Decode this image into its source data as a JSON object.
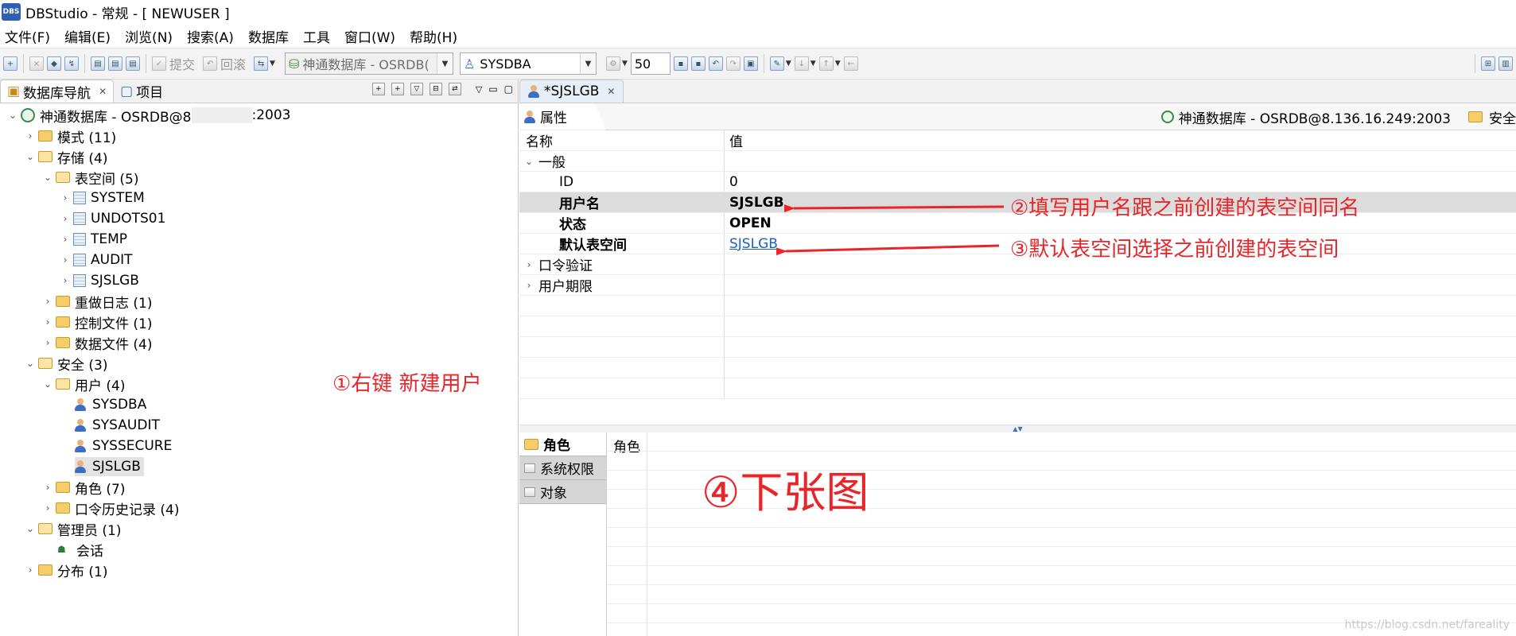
{
  "window": {
    "app_icon_text": "DBS",
    "title": "DBStudio - 常规 - [ NEWUSER ]"
  },
  "menu": [
    "文件(F)",
    "编辑(E)",
    "浏览(N)",
    "搜索(A)",
    "数据库",
    "工具",
    "窗口(W)",
    "帮助(H)"
  ],
  "toolbar": {
    "commit_label": "提交",
    "rollback_label": "回滚",
    "db_combo": "神通数据库 - OSRDB(",
    "user_combo": "SYSDBA",
    "limit_value": "50"
  },
  "left_tabs": {
    "navigator": "数据库导航",
    "project": "项目"
  },
  "tree": {
    "root": {
      "label_prefix": "神通数据库 - OSRDB@8",
      "label_suffix": ":2003"
    },
    "schema": "模式 (11)",
    "storage": "存储 (4)",
    "tablespace": "表空间 (5)",
    "tablespaces": [
      "SYSTEM",
      "UNDOTS01",
      "TEMP",
      "AUDIT",
      "SJSLGB"
    ],
    "redo": "重做日志 (1)",
    "control": "控制文件 (1)",
    "datafile": "数据文件 (4)",
    "security": "安全 (3)",
    "users_group": "用户 (4)",
    "users": [
      "SYSDBA",
      "SYSAUDIT",
      "SYSSECURE",
      "SJSLGB"
    ],
    "roles": "角色 (7)",
    "pwd_history": "口令历史记录 (4)",
    "admin": "管理员 (1)",
    "session": "会话",
    "distribution": "分布 (1)"
  },
  "editor": {
    "tab_label": "*SJSLGB",
    "props_tab": "属性",
    "connection": "神通数据库 - OSRDB@8.136.16.249:2003",
    "security_label": "安全",
    "col_name": "名称",
    "col_value": "值",
    "group_general": "一般",
    "rows": [
      {
        "name": "ID",
        "value": "0"
      },
      {
        "name": "用户名",
        "value": "SJSLGB"
      },
      {
        "name": "状态",
        "value": "OPEN"
      },
      {
        "name": "默认表空间",
        "value": "SJSLGB"
      }
    ],
    "group_pwd": "口令验证",
    "group_limit": "用户期限",
    "side_tabs": [
      "角色",
      "系统权限",
      "对象"
    ],
    "roles_header": "角色"
  },
  "annotations": {
    "a1": "①右键 新建用户",
    "a2": "②填写用户名跟之前创建的表空间同名",
    "a3": "③默认表空间选择之前创建的表空间",
    "a4": "④下张图"
  },
  "colors": {
    "annotation": "#e8262a",
    "link": "#1a5fd0",
    "selection": "#dcdcdc"
  },
  "watermark": "https://blog.csdn.net/fareality"
}
